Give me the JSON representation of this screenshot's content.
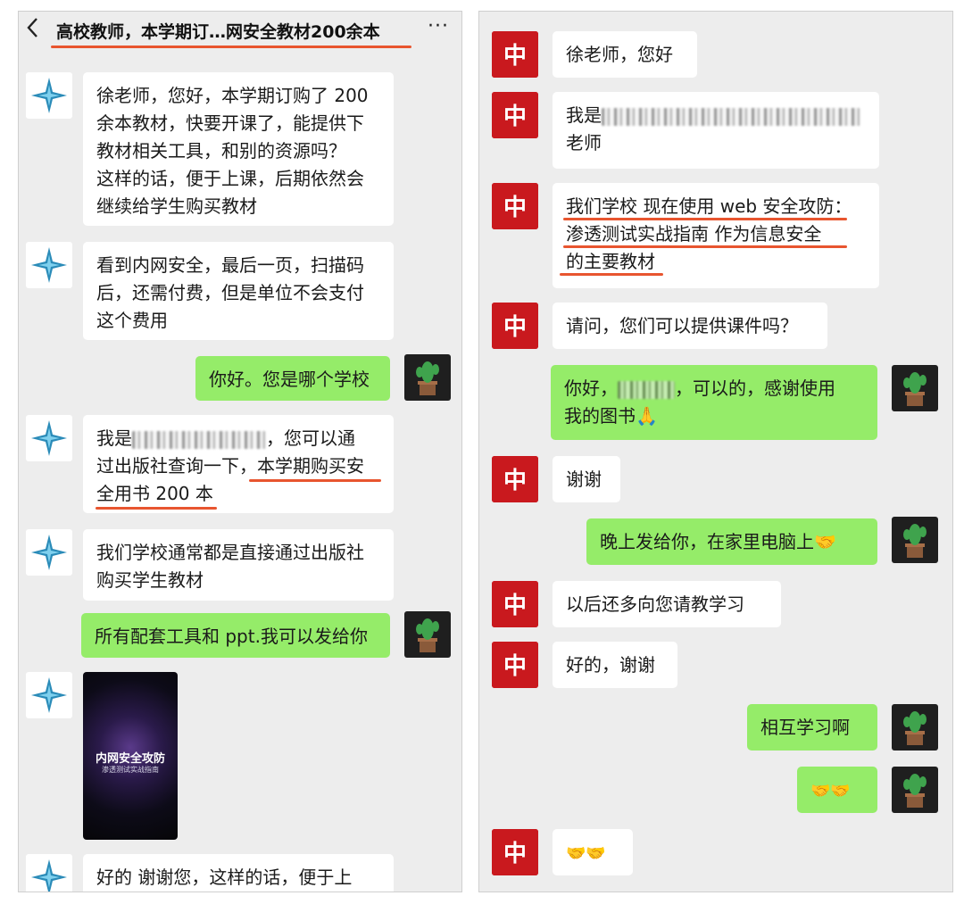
{
  "left": {
    "back_icon": "chevron-left-icon",
    "title": "高校教师，本学期订…网安全教材200余本",
    "more_label": "···",
    "messages": [
      {
        "text": "徐老师，您好，本学期订购了 200\n余本教材，快要开课了，能提供下\n教材相关工具，和别的资源吗？\n这样的话，便于上课，后期依然会\n继续给学生购买教材"
      },
      {
        "text": "看到内网安全，最后一页，扫描码\n后，还需付费，但是单位不会支付\n这个费用"
      },
      {
        "text": "你好。您是哪个学校"
      },
      {
        "pre": "我是",
        "post": "，您可以通\n过出版社查询一下，本学期购买安\n全用书 200 本"
      },
      {
        "text": "我们学校通常都是直接通过出版社\n购买学生教材"
      },
      {
        "text": "所有配套工具和 ppt.我可以发给你"
      },
      {
        "book_title": "内网安全攻防",
        "book_subtitle": "渗透测试实战指南"
      },
      {
        "text": "好的 谢谢您，这样的话，便于上课，"
      }
    ]
  },
  "right": {
    "messages": [
      {
        "text": "徐老师，您好"
      },
      {
        "pre": "我是",
        "post": "\n老师"
      },
      {
        "text": "我们学校 现在使用 web 安全攻防：\n渗透测试实战指南 作为信息安全\n的主要教材"
      },
      {
        "text": "请问，您们可以提供课件吗？"
      },
      {
        "pre": "你好，",
        "post": "，可以的，感谢使用\n我的图书🙏"
      },
      {
        "text": "谢谢"
      },
      {
        "text": "晚上发给你，在家里电脑上🤝"
      },
      {
        "text": "以后还多向您请教学习"
      },
      {
        "text": "好的，谢谢"
      },
      {
        "text": "相互学习啊"
      },
      {
        "text": "🤝🤝"
      },
      {
        "text": "🤝🤝"
      }
    ]
  },
  "icons": {
    "left_contact_avatar": "compass-star-icon",
    "right_contact_avatar": "china-logo-icon",
    "self_avatar": "cactus-icon"
  },
  "colors": {
    "green_bubble": "#95ec69",
    "white_bubble": "#ffffff",
    "underline": "#e8552f",
    "chat_bg": "#ededed"
  }
}
